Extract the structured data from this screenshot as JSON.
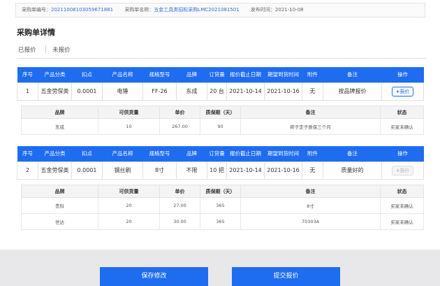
{
  "info": {
    "order_no_label": "采购单编号：",
    "order_no": "20211008103059671881",
    "order_name_label": "采购单名称：",
    "order_name": "五金工具类招标采购LMC2021081501",
    "publish_label": "发布时间：",
    "publish_date": "2021-10-08"
  },
  "page_title": "采购单详情",
  "tabs": {
    "quoted": "已报价",
    "unquoted": "未报价"
  },
  "order_columns": [
    "序号",
    "产品分类",
    "扣点",
    "产品名称",
    "规格型号",
    "品牌",
    "订货量",
    "报价截止日期",
    "期望到货时间",
    "附件",
    "备注",
    "操作"
  ],
  "bid_columns": [
    "品牌",
    "可供货量",
    "单价",
    "质保期（天）",
    "备注",
    "状态"
  ],
  "orders": [
    {
      "row": [
        "1",
        "五金劳保类",
        "0.0001",
        "电锤",
        "FF-26",
        "东成",
        "20 台",
        "2021-10-14",
        "2021-10-16",
        "无",
        "按品牌报价"
      ],
      "action": "报价",
      "action_icon": "+",
      "action_state": "active",
      "bids": [
        [
          "东成",
          "10",
          "267.00",
          "90",
          "砖子定子质保三个月",
          "买家未确认"
        ]
      ]
    },
    {
      "row": [
        "2",
        "五金劳保类",
        "0.0001",
        "钢丝刷",
        "8寸",
        "不限",
        "10 把",
        "2021-10-14",
        "2021-10-16",
        "无",
        "质量好的"
      ],
      "action": "报价",
      "action_icon": "+",
      "action_state": "disabled",
      "bids": [
        [
          "贵科",
          "20",
          "27.00",
          "365",
          "8寸",
          "买家未确认"
        ],
        [
          "世达",
          "20",
          "30.00",
          "365",
          "70303A",
          "买家未确认"
        ]
      ]
    }
  ],
  "footer": {
    "save": "保存修改",
    "submit": "提交报价"
  }
}
